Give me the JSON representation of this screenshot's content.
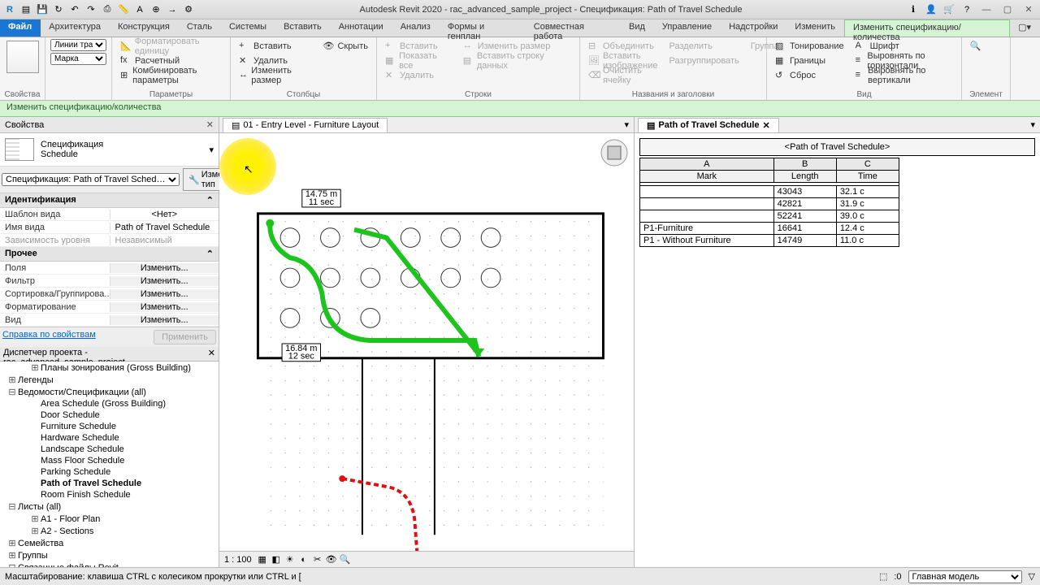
{
  "title": "Autodesk Revit 2020 - rac_advanced_sample_project - Спецификация: Path of Travel Schedule",
  "ribbon": {
    "file": "Файл",
    "tabs": [
      "Архитектура",
      "Конструкция",
      "Сталь",
      "Системы",
      "Вставить",
      "Аннотации",
      "Анализ",
      "Формы и генплан",
      "Совместная работа",
      "Вид",
      "Управление",
      "Надстройки",
      "Изменить"
    ],
    "active_tab": "Изменить спецификацию/количества",
    "panels": {
      "properties": {
        "title": "Свойства",
        "lines": "Линии трае…",
        "mark": "Марка"
      },
      "parameters": {
        "title": "Параметры",
        "format_unit": "Форматировать единицу",
        "calculated": "Расчетный",
        "combine": "Комбинировать параметры"
      },
      "columns": {
        "title": "Столбцы",
        "insert": "Вставить",
        "delete": "Удалить",
        "resize": "Изменить размер",
        "hide": "Скрыть"
      },
      "rows": {
        "title": "Строки",
        "insert": "Вставить",
        "show_all": "Показать все",
        "insert_data_row": "Вставить строку данных",
        "delete": "Удалить",
        "resize": "Изменить размер"
      },
      "titles": {
        "title": "Названия и заголовки",
        "merge": "Объединить",
        "split": "Разделить",
        "group": "Группа",
        "insert_img": "Вставить изображение",
        "ungroup": "Разгруппировать",
        "clear_cell": "Очистить ячейку"
      },
      "view": {
        "title": "Вид",
        "shading": "Тонирование",
        "borders": "Границы",
        "reset": "Сброс",
        "font": "Шрифт",
        "align_h": "Выровнять по горизонтали",
        "align_v": "Выровнять по вертикали"
      },
      "element": {
        "title": "Элемент",
        "highlight": "Выделить в модели"
      }
    }
  },
  "context_bar": "Изменить спецификацию/количества",
  "properties_panel": {
    "title": "Свойства",
    "type_name": "Спецификация",
    "type_sub": "Schedule",
    "filter_label": "Спецификация: Path of Travel Sched…",
    "edit_type": "Изменить тип",
    "sections": {
      "ident": {
        "title": "Идентификация",
        "rows": [
          {
            "k": "Шаблон вида",
            "v": "<Нет>"
          },
          {
            "k": "Имя вида",
            "v": "Path of Travel Schedule"
          },
          {
            "k": "Зависимость уровня",
            "v": "Независимый"
          }
        ]
      },
      "other": {
        "title": "Прочее",
        "rows": [
          {
            "k": "Поля",
            "v": "Изменить..."
          },
          {
            "k": "Фильтр",
            "v": "Изменить..."
          },
          {
            "k": "Сортировка/Группирова...",
            "v": "Изменить..."
          },
          {
            "k": "Форматирование",
            "v": "Изменить..."
          },
          {
            "k": "Вид",
            "v": "Изменить..."
          }
        ]
      }
    },
    "help_link": "Справка по свойствам",
    "apply": "Применить"
  },
  "browser": {
    "title": "Диспетчер проекта - rac_advanced_sample_project",
    "items": [
      {
        "l": 2,
        "t": "Планы зонирования (Gross Building)",
        "exp": "+"
      },
      {
        "l": 1,
        "t": "Легенды",
        "exp": "+"
      },
      {
        "l": 1,
        "t": "Ведомости/Спецификации (all)",
        "exp": "−"
      },
      {
        "l": 2,
        "t": "Area Schedule (Gross Building)"
      },
      {
        "l": 2,
        "t": "Door Schedule"
      },
      {
        "l": 2,
        "t": "Furniture Schedule"
      },
      {
        "l": 2,
        "t": "Hardware Schedule"
      },
      {
        "l": 2,
        "t": "Landscape Schedule"
      },
      {
        "l": 2,
        "t": "Mass Floor Schedule"
      },
      {
        "l": 2,
        "t": "Parking Schedule"
      },
      {
        "l": 2,
        "t": "Path of Travel Schedule",
        "bold": true
      },
      {
        "l": 2,
        "t": "Room Finish Schedule"
      },
      {
        "l": 1,
        "t": "Листы (all)",
        "exp": "−"
      },
      {
        "l": 2,
        "t": "A1 - Floor Plan",
        "exp": "+"
      },
      {
        "l": 2,
        "t": "A2 - Sections",
        "exp": "+"
      },
      {
        "l": 1,
        "t": "Семейства",
        "exp": "+"
      },
      {
        "l": 1,
        "t": "Группы",
        "exp": "+"
      },
      {
        "l": 1,
        "t": "Связанные файлы Revit",
        "exp": "−"
      }
    ]
  },
  "center_view": {
    "tab": "01 - Entry Level - Furniture Layout",
    "dim1": "14.75 m",
    "dim1_sub": "11 sec",
    "dim2": "16.84 m",
    "dim2_sub": "12 sec",
    "scale": "1 : 100"
  },
  "schedule": {
    "tab": "Path of Travel Schedule",
    "title": "<Path of Travel Schedule>",
    "cols_letter": [
      "A",
      "B",
      "C"
    ],
    "cols": [
      "Mark",
      "Length",
      "Time"
    ],
    "rows": [
      {
        "m": "",
        "l": "43043",
        "t": "32.1 c"
      },
      {
        "m": "",
        "l": "42821",
        "t": "31.9 c"
      },
      {
        "m": "",
        "l": "52241",
        "t": "39.0 c"
      },
      {
        "m": "P1-Furniture",
        "l": "16641",
        "t": "12.4 c"
      },
      {
        "m": "P1 - Without Furniture",
        "l": "14749",
        "t": "11.0 c"
      }
    ]
  },
  "status": {
    "left": "Масштабирование: клавиша CTRL с колесиком прокрутки или CTRL и [",
    "model": "Главная модель"
  }
}
